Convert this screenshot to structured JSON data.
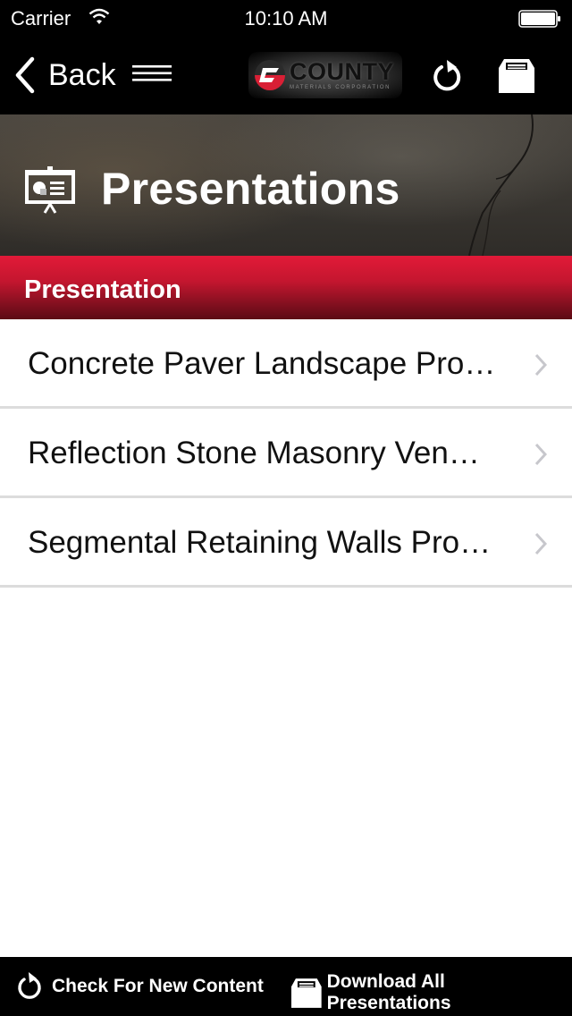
{
  "status_bar": {
    "carrier": "Carrier",
    "time": "10:10 AM",
    "icons": [
      "wifi-icon",
      "battery-icon"
    ]
  },
  "nav": {
    "back_label": "Back",
    "icons": [
      "chevron-left-icon",
      "menu-icon",
      "refresh-icon",
      "download-box-icon"
    ],
    "logo": {
      "brand": "COUNTY",
      "subtitle": "MATERIALS CORPORATION"
    }
  },
  "hero": {
    "title": "Presentations",
    "icon": "presentation-board-icon"
  },
  "section": {
    "label": "Presentation",
    "color_top": "#e21a38",
    "color_bottom": "#5c0a14"
  },
  "list": {
    "items": [
      {
        "label": "Concrete Paver Landscape Pro…"
      },
      {
        "label": "Reflection Stone Masonry Ven…"
      },
      {
        "label": "Segmental Retaining Walls Pro…"
      }
    ]
  },
  "toolbar": {
    "check_label": "Check For New Content",
    "download_label": "Download All Presentations"
  }
}
